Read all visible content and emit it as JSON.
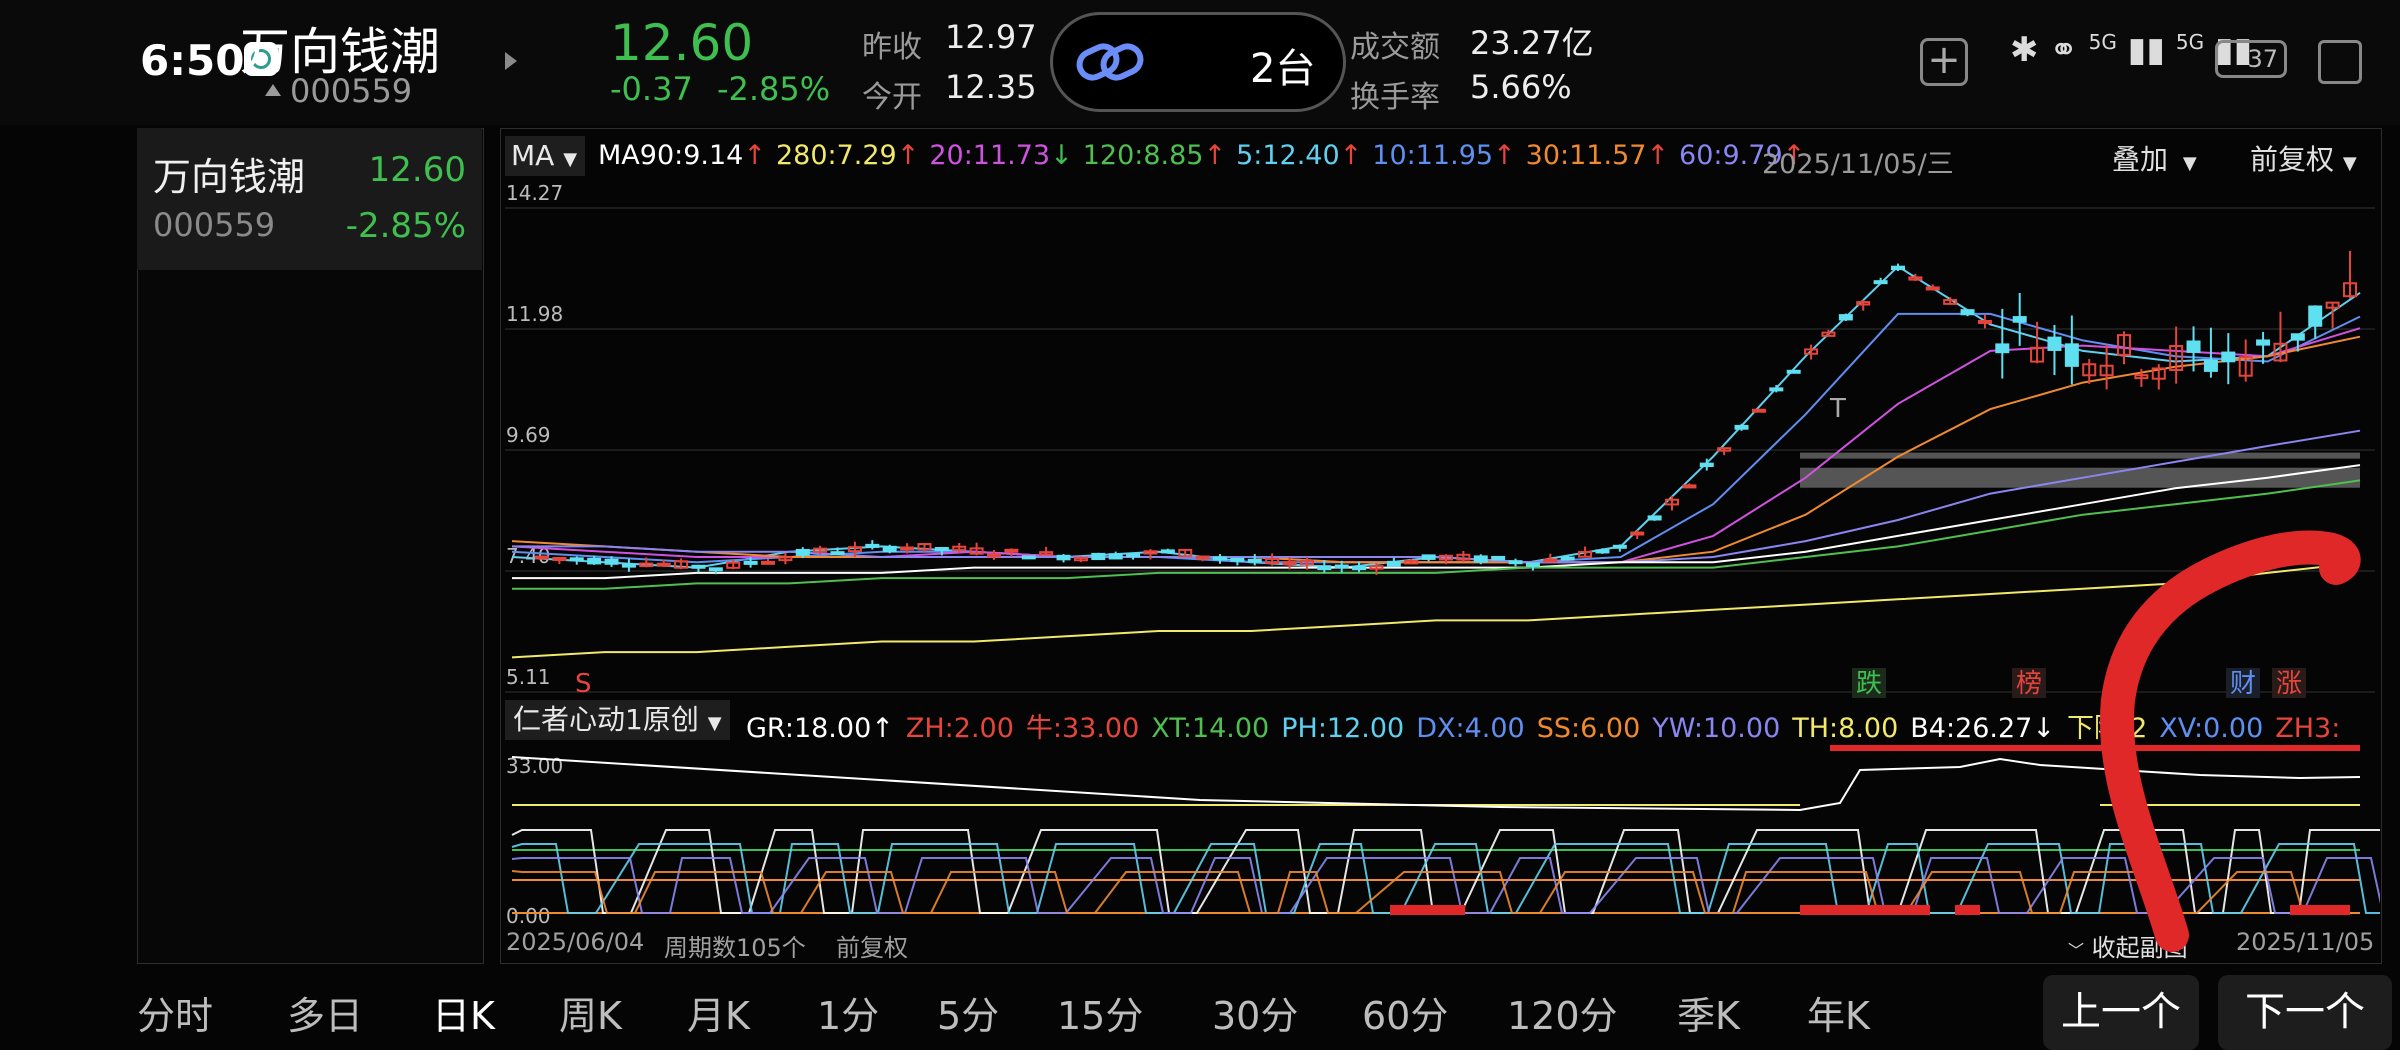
{
  "status": {
    "time": "6:50",
    "network": "5G",
    "battery": "37"
  },
  "header": {
    "stock_name": "万向钱潮",
    "stock_code": "000559",
    "price": "12.60",
    "change": "-0.37",
    "change_pct": "-2.85%",
    "prev_close_label": "昨收",
    "prev_close": "12.97",
    "open_label": "今开",
    "open": "12.35",
    "link_count": "2台",
    "turnover_label": "成交额",
    "turnover": "23.27亿",
    "turnover_rate_label": "换手率",
    "turnover_rate": "5.66%"
  },
  "sidebar": {
    "items": [
      {
        "name": "万向钱潮",
        "code": "000559",
        "price": "12.60",
        "change_pct": "-2.85%"
      }
    ]
  },
  "chart": {
    "ma_selector": "MA",
    "ma_legend": [
      {
        "label": "MA90:9.14",
        "arrow": "↑",
        "color": "#ffffff",
        "arrow_color": "#e5453b"
      },
      {
        "label": "280:7.29",
        "arrow": "↑",
        "color": "#f2e86a",
        "arrow_color": "#e5453b"
      },
      {
        "label": "20:11.73",
        "arrow": "↓",
        "color": "#d052e0",
        "arrow_color": "#3fbf4f"
      },
      {
        "label": "120:8.85",
        "arrow": "↑",
        "color": "#4fbf4f",
        "arrow_color": "#e5453b"
      },
      {
        "label": "5:12.40",
        "arrow": "↑",
        "color": "#5fd0f0",
        "arrow_color": "#e5453b"
      },
      {
        "label": "10:11.95",
        "arrow": "↑",
        "color": "#5f8ff0",
        "arrow_color": "#e5453b"
      },
      {
        "label": "30:11.57",
        "arrow": "↑",
        "color": "#f08a30",
        "arrow_color": "#e5453b"
      },
      {
        "label": "60:9.79",
        "arrow": "↑",
        "color": "#8a86f0",
        "arrow_color": "#e5453b"
      }
    ],
    "date": "2025/11/05/三",
    "overlay_label": "叠加",
    "adjust_label": "前复权",
    "price_ticks": [
      "14.27",
      "11.98",
      "9.69",
      "7.40",
      "5.11"
    ],
    "markers": {
      "s": "S",
      "t": "T",
      "die": "跌",
      "bang": "榜",
      "cai": "财",
      "zhang": "涨"
    },
    "indicator_name": "仁者心动1原创",
    "indicator_legend": [
      {
        "label": "GR:18.00",
        "arrow": "↑",
        "color": "#ffffff"
      },
      {
        "label": "ZH:2.00",
        "color": "#e5453b"
      },
      {
        "label": "牛:33.00",
        "color": "#e5453b"
      },
      {
        "label": "XT:14.00",
        "color": "#4fbf4f"
      },
      {
        "label": "PH:12.00",
        "color": "#5fd0f0"
      },
      {
        "label": "DX:4.00",
        "color": "#5f8ff0"
      },
      {
        "label": "SS:6.00",
        "color": "#f08a30"
      },
      {
        "label": "YW:10.00",
        "color": "#8a86f0"
      },
      {
        "label": "TH:8.00",
        "color": "#f2e86a"
      },
      {
        "label": "B4:26.27",
        "arrow": "↓",
        "color": "#ffffff"
      },
      {
        "label": "下降:2",
        "color": "#f2e86a"
      },
      {
        "label": "XV:0.00",
        "color": "#5f8ff0"
      },
      {
        "label": "ZH3:",
        "color": "#e5453b"
      }
    ],
    "ind_ticks": [
      "33.00",
      "0.00"
    ],
    "start_date": "2025/06/04",
    "periods": "周期数105个",
    "footer_adjust": "前复权",
    "collapse_label": "收起副图",
    "end_date": "2025/11/05",
    "colors": {
      "up": "#e5453b",
      "down": "#5fe0f0",
      "accent_green": "#3fbf4f"
    }
  },
  "chart_data": {
    "type": "line",
    "title": "",
    "x": [
      "2025/06/04",
      "2025/11/05"
    ],
    "series": [
      {
        "name": "5",
        "values": [
          7.4,
          7.3,
          7.2,
          7.5,
          7.6,
          7.5,
          7.4,
          7.5,
          7.3,
          7.2,
          7.4,
          7.3,
          7.6,
          9.3,
          11.2,
          12.9,
          11.8,
          11.3,
          11.1,
          11.2,
          12.4
        ]
      },
      {
        "name": "10",
        "values": [
          7.5,
          7.4,
          7.3,
          7.4,
          7.5,
          7.5,
          7.4,
          7.4,
          7.3,
          7.3,
          7.3,
          7.3,
          7.4,
          8.4,
          10.1,
          12.0,
          12.0,
          11.5,
          11.2,
          11.1,
          11.95
        ]
      },
      {
        "name": "20",
        "values": [
          7.6,
          7.5,
          7.4,
          7.4,
          7.4,
          7.5,
          7.4,
          7.4,
          7.4,
          7.3,
          7.3,
          7.3,
          7.3,
          7.8,
          8.9,
          10.3,
          11.3,
          11.4,
          11.3,
          11.2,
          11.73
        ]
      },
      {
        "name": "30",
        "values": [
          7.7,
          7.6,
          7.5,
          7.4,
          7.4,
          7.4,
          7.4,
          7.4,
          7.4,
          7.3,
          7.3,
          7.3,
          7.3,
          7.5,
          8.2,
          9.3,
          10.2,
          10.7,
          11.0,
          11.2,
          11.57
        ]
      },
      {
        "name": "60",
        "values": [
          7.6,
          7.6,
          7.5,
          7.5,
          7.4,
          7.4,
          7.4,
          7.4,
          7.4,
          7.4,
          7.4,
          7.3,
          7.3,
          7.4,
          7.7,
          8.1,
          8.6,
          8.9,
          9.2,
          9.5,
          9.79
        ]
      },
      {
        "name": "MA90",
        "values": [
          7.0,
          7.0,
          7.1,
          7.1,
          7.1,
          7.2,
          7.2,
          7.2,
          7.2,
          7.2,
          7.2,
          7.2,
          7.3,
          7.3,
          7.5,
          7.8,
          8.1,
          8.4,
          8.7,
          8.9,
          9.14
        ]
      },
      {
        "name": "120",
        "values": [
          6.8,
          6.8,
          6.9,
          6.9,
          7.0,
          7.0,
          7.0,
          7.1,
          7.1,
          7.1,
          7.1,
          7.2,
          7.2,
          7.2,
          7.4,
          7.6,
          7.9,
          8.2,
          8.4,
          8.6,
          8.85
        ]
      },
      {
        "name": "280",
        "values": [
          5.5,
          5.6,
          5.6,
          5.7,
          5.8,
          5.8,
          5.9,
          6.0,
          6.0,
          6.1,
          6.2,
          6.2,
          6.3,
          6.4,
          6.5,
          6.6,
          6.7,
          6.8,
          6.9,
          7.1,
          7.29
        ]
      }
    ],
    "ylim": [
      5.11,
      14.27
    ],
    "xlabel": "",
    "ylabel": ""
  },
  "tabs": [
    "分时",
    "多日",
    "日K",
    "周K",
    "月K",
    "1分",
    "5分",
    "15分",
    "30分",
    "60分",
    "120分",
    "季K",
    "年K"
  ],
  "active_tab": "日K",
  "nav": {
    "prev": "上一个",
    "next": "下一个"
  }
}
